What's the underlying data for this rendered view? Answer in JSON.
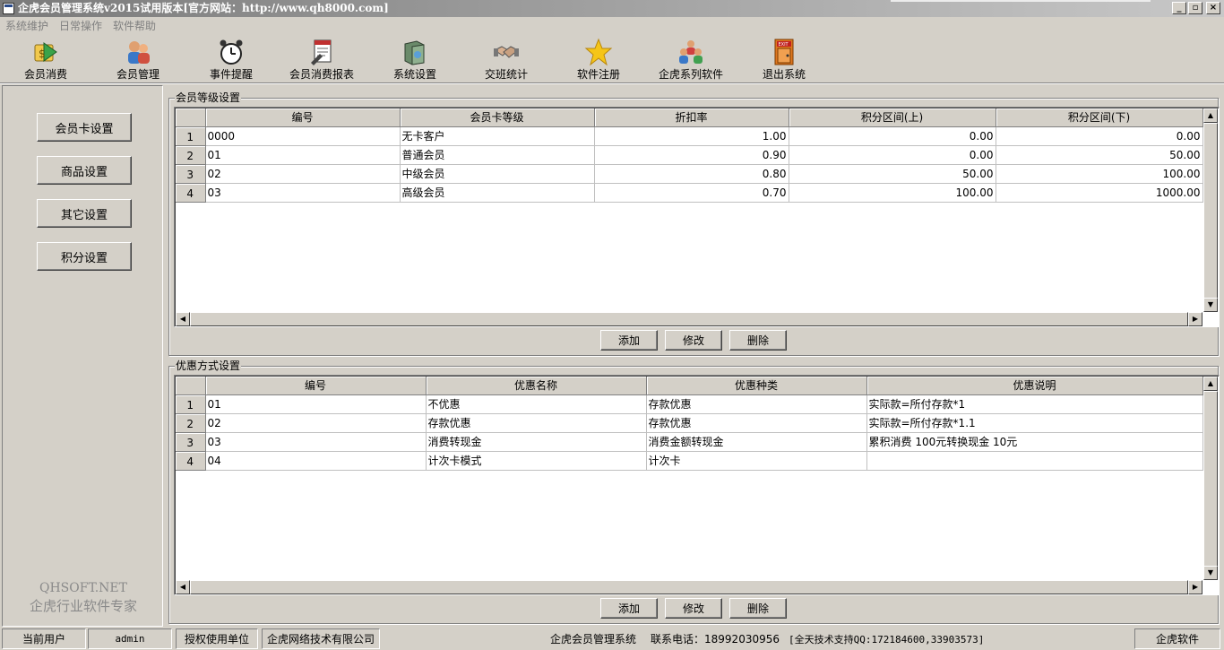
{
  "window": {
    "title": "企虎会员管理系统v2015试用版本[官方网站：http://www.qh8000.com]",
    "controls": [
      "_",
      "▫",
      "×"
    ]
  },
  "menu": [
    "系统维护",
    "日常操作",
    "软件帮助"
  ],
  "toolbar": [
    {
      "label": "会员消费",
      "icon": "member-consume-icon"
    },
    {
      "label": "会员管理",
      "icon": "member-manage-icon"
    },
    {
      "label": "事件提醒",
      "icon": "alarm-clock-icon"
    },
    {
      "label": "会员消费报表",
      "icon": "report-icon"
    },
    {
      "label": "系统设置",
      "icon": "settings-book-icon"
    },
    {
      "label": "交班统计",
      "icon": "handshake-icon"
    },
    {
      "label": "软件注册",
      "icon": "star-icon"
    },
    {
      "label": "企虎系列软件",
      "icon": "people-group-icon"
    },
    {
      "label": "退出系统",
      "icon": "exit-door-icon"
    }
  ],
  "sidebar": {
    "buttons": [
      "会员卡设置",
      "商品设置",
      "其它设置",
      "积分设置"
    ],
    "brand_en": "QHSOFT.NET",
    "brand_cn": "企虎行业软件专家"
  },
  "level_panel": {
    "title": "会员等级设置",
    "columns": [
      "编号",
      "会员卡等级",
      "折扣率",
      "积分区间(上)",
      "积分区间(下)"
    ],
    "rows": [
      {
        "n": "1",
        "cells": [
          "0000",
          "无卡客户",
          "1.00",
          "0.00",
          "0.00"
        ]
      },
      {
        "n": "2",
        "cells": [
          "01",
          "普通会员",
          "0.90",
          "0.00",
          "50.00"
        ]
      },
      {
        "n": "3",
        "cells": [
          "02",
          "中级会员",
          "0.80",
          "50.00",
          "100.00"
        ]
      },
      {
        "n": "4",
        "cells": [
          "03",
          "高级会员",
          "0.70",
          "100.00",
          "1000.00"
        ]
      }
    ],
    "buttons": [
      "添加",
      "修改",
      "删除"
    ]
  },
  "promo_panel": {
    "title": "优惠方式设置",
    "columns": [
      "编号",
      "优惠名称",
      "优惠种类",
      "优惠说明"
    ],
    "rows": [
      {
        "n": "1",
        "cells": [
          "01",
          "不优惠",
          "存款优惠",
          "实际款=所付存款*1"
        ]
      },
      {
        "n": "2",
        "cells": [
          "02",
          "存款优惠",
          "存款优惠",
          "实际款=所付存款*1.1"
        ]
      },
      {
        "n": "3",
        "cells": [
          "03",
          "消费转现金",
          "消费金额转现金",
          "累积消费 100元转换现金 10元"
        ]
      },
      {
        "n": "4",
        "cells": [
          "04",
          "计次卡模式",
          "计次卡",
          ""
        ]
      }
    ],
    "buttons": [
      "添加",
      "修改",
      "删除"
    ]
  },
  "status": {
    "current_user_label": "当前用户",
    "current_user": "admin",
    "licensed_label": "授权使用单位",
    "licensed_to": "企虎网络技术有限公司",
    "system_name": "企虎会员管理系统",
    "contact": "联系电话：18992030956",
    "support": "[全天技术支持QQ:172184600,33903573]",
    "vendor": "企虎软件"
  }
}
